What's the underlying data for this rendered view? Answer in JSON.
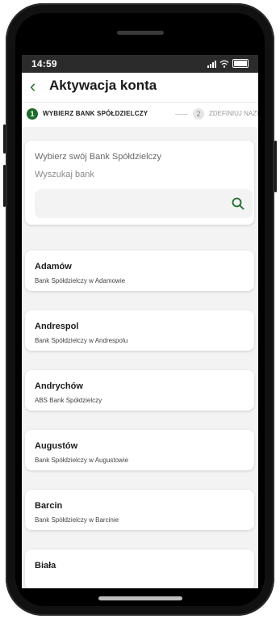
{
  "status": {
    "time": "14:59"
  },
  "header": {
    "title": "Aktywacja konta",
    "back_icon": "chevron-left-icon"
  },
  "stepper": {
    "steps": [
      {
        "number": "1",
        "label": "WYBIERZ BANK SPÓŁDZIELCZY",
        "active": true
      },
      {
        "number": "2",
        "label": "ZDEFINIUJ NAZWE",
        "active": false
      }
    ]
  },
  "search": {
    "heading": "Wybierz swój Bank Spółdzielczy",
    "label": "Wyszukaj bank",
    "value": "",
    "placeholder": ""
  },
  "banks": [
    {
      "name": "Adamów",
      "desc": "Bank Spółdzielczy w Adamowie"
    },
    {
      "name": "Andrespol",
      "desc": "Bank Spółdzielczy w Andrespolu"
    },
    {
      "name": "Andrychów",
      "desc": "ABS Bank Spółdzielczy"
    },
    {
      "name": "Augustów",
      "desc": "Bank Spółdzielczy w Augustowie"
    },
    {
      "name": "Barcin",
      "desc": "Bank Spółdzielczy w Barcinie"
    },
    {
      "name": "Biała",
      "desc": ""
    }
  ],
  "colors": {
    "accent": "#1f6b2b",
    "background": "#f3f3f3",
    "statusbar": "#2b2b2b"
  }
}
